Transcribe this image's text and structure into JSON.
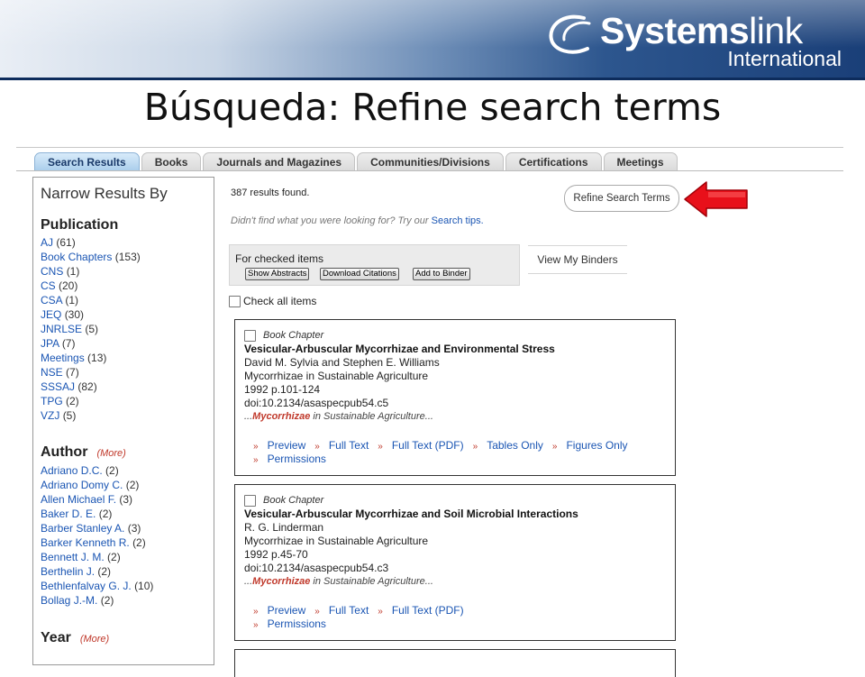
{
  "logo": {
    "brand_bold": "Systems",
    "brand_light": "link",
    "sub": "International"
  },
  "slide_title": "Búsqueda: Refine search terms",
  "tabs": [
    "Search Results",
    "Books",
    "Journals and Magazines",
    "Communities/Divisions",
    "Certifications",
    "Meetings"
  ],
  "active_tab": 0,
  "sidebar": {
    "heading": "Narrow Results By",
    "publication": {
      "title": "Publication",
      "items": [
        {
          "label": "AJ",
          "count": "(61)"
        },
        {
          "label": "Book Chapters",
          "count": "(153)"
        },
        {
          "label": "CNS",
          "count": "(1)"
        },
        {
          "label": "CS",
          "count": "(20)"
        },
        {
          "label": "CSA",
          "count": "(1)"
        },
        {
          "label": "JEQ",
          "count": "(30)"
        },
        {
          "label": "JNRLSE",
          "count": "(5)"
        },
        {
          "label": "JPA",
          "count": "(7)"
        },
        {
          "label": "Meetings",
          "count": "(13)"
        },
        {
          "label": "NSE",
          "count": "(7)"
        },
        {
          "label": "SSSAJ",
          "count": "(82)"
        },
        {
          "label": "TPG",
          "count": "(2)"
        },
        {
          "label": "VZJ",
          "count": "(5)"
        }
      ]
    },
    "author": {
      "title": "Author",
      "more": "(More)",
      "items": [
        {
          "label": "Adriano D.C.",
          "count": "(2)"
        },
        {
          "label": "Adriano Domy C.",
          "count": "(2)"
        },
        {
          "label": "Allen Michael F.",
          "count": "(3)"
        },
        {
          "label": "Baker D. E.",
          "count": "(2)"
        },
        {
          "label": "Barber Stanley A.",
          "count": "(3)"
        },
        {
          "label": "Barker Kenneth R.",
          "count": "(2)"
        },
        {
          "label": "Bennett J. M.",
          "count": "(2)"
        },
        {
          "label": "Berthelin J.",
          "count": "(2)"
        },
        {
          "label": "Bethlenfalvay G. J.",
          "count": "(10)"
        },
        {
          "label": "Bollag J.-M.",
          "count": "(2)"
        }
      ]
    },
    "year": {
      "title": "Year",
      "more": "(More)"
    }
  },
  "main": {
    "results_found": "387 results found.",
    "tips_text": "Didn't find what you were looking for? Try our",
    "tips_link": "Search tips.",
    "refine_button": "Refine Search Terms",
    "checked_label": "For checked items",
    "buttons": [
      "Show Abstracts",
      "Download Citations",
      "Add to Binder"
    ],
    "binders": "View My Binders",
    "check_all": "Check all items"
  },
  "results": [
    {
      "type": "Book Chapter",
      "title": "Vesicular-Arbuscular Mycorrhizae and Environmental Stress",
      "authors": "David M. Sylvia and Stephen E. Williams",
      "book": "Mycorrhizae in Sustainable Agriculture",
      "pages": "1992 p.101-124",
      "doi": "doi:10.2134/asaspecpub54.c5",
      "snippet_pre": "...",
      "snippet_hl": "Mycorrhizae",
      "snippet_post": " in Sustainable Agriculture...",
      "links": [
        "Preview",
        "Full Text",
        "Full Text (PDF)",
        "Tables Only",
        "Figures Only"
      ],
      "links2": [
        "Permissions"
      ]
    },
    {
      "type": "Book Chapter",
      "title": "Vesicular-Arbuscular Mycorrhizae and Soil Microbial Interactions",
      "authors": "R. G. Linderman",
      "book": "Mycorrhizae in Sustainable Agriculture",
      "pages": "1992 p.45-70",
      "doi": "doi:10.2134/asaspecpub54.c3",
      "snippet_pre": "...",
      "snippet_hl": "Mycorrhizae",
      "snippet_post": " in Sustainable Agriculture...",
      "links": [
        "Preview",
        "Full Text",
        "Full Text (PDF)"
      ],
      "links2": [
        "Permissions"
      ]
    }
  ],
  "colors": {
    "link": "#1a55b3",
    "highlight": "#c0392b",
    "arrow": "#e8101a",
    "banner_dark": "#1a3f78"
  }
}
